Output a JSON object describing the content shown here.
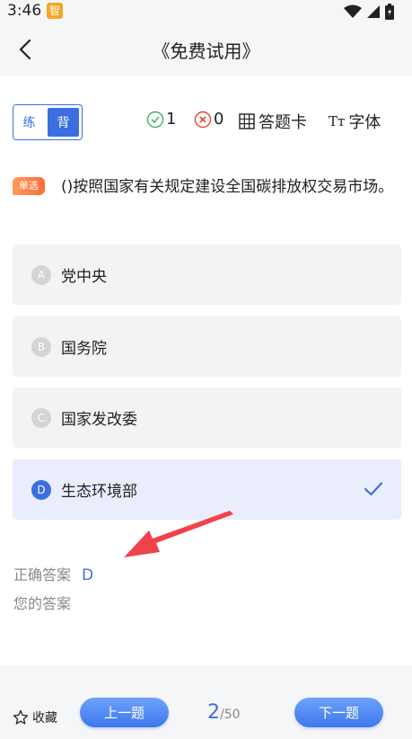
{
  "status_bar": {
    "time": "3:46",
    "app_badge": "智"
  },
  "nav": {
    "title": "《免费试用》"
  },
  "toolbar": {
    "mode_practice": "练",
    "mode_recite": "背",
    "correct_count": "1",
    "wrong_count": "0",
    "answer_card": "答题卡",
    "font_label": "字体",
    "font_icon_text": "Tт"
  },
  "question": {
    "type_badge": "单选",
    "text": "()按照国家有关规定建设全国碳排放权交易市场。"
  },
  "options": [
    {
      "letter": "A",
      "text": "党中央",
      "selected": false
    },
    {
      "letter": "B",
      "text": "国务院",
      "selected": false
    },
    {
      "letter": "C",
      "text": "国家发改委",
      "selected": false
    },
    {
      "letter": "D",
      "text": "生态环境部",
      "selected": true
    }
  ],
  "answer": {
    "correct_label": "正确答案",
    "correct_value": "D",
    "yours_label": "您的答案"
  },
  "bottom": {
    "favorite": "收藏",
    "prev": "上一题",
    "next": "下一题",
    "page_current": "2",
    "page_total": "/50"
  },
  "colors": {
    "accent": "#3b6fe0",
    "badge_orange": "#ff7a45",
    "correct_green": "#3bb36b",
    "wrong_red": "#e8453c",
    "arrow_red": "#f0424a"
  },
  "icons": [
    "back-arrow-icon",
    "check-circle-icon",
    "x-circle-icon",
    "grid-icon",
    "star-icon",
    "checkmark-icon",
    "wifi-icon",
    "signal-icon",
    "battery-icon"
  ]
}
